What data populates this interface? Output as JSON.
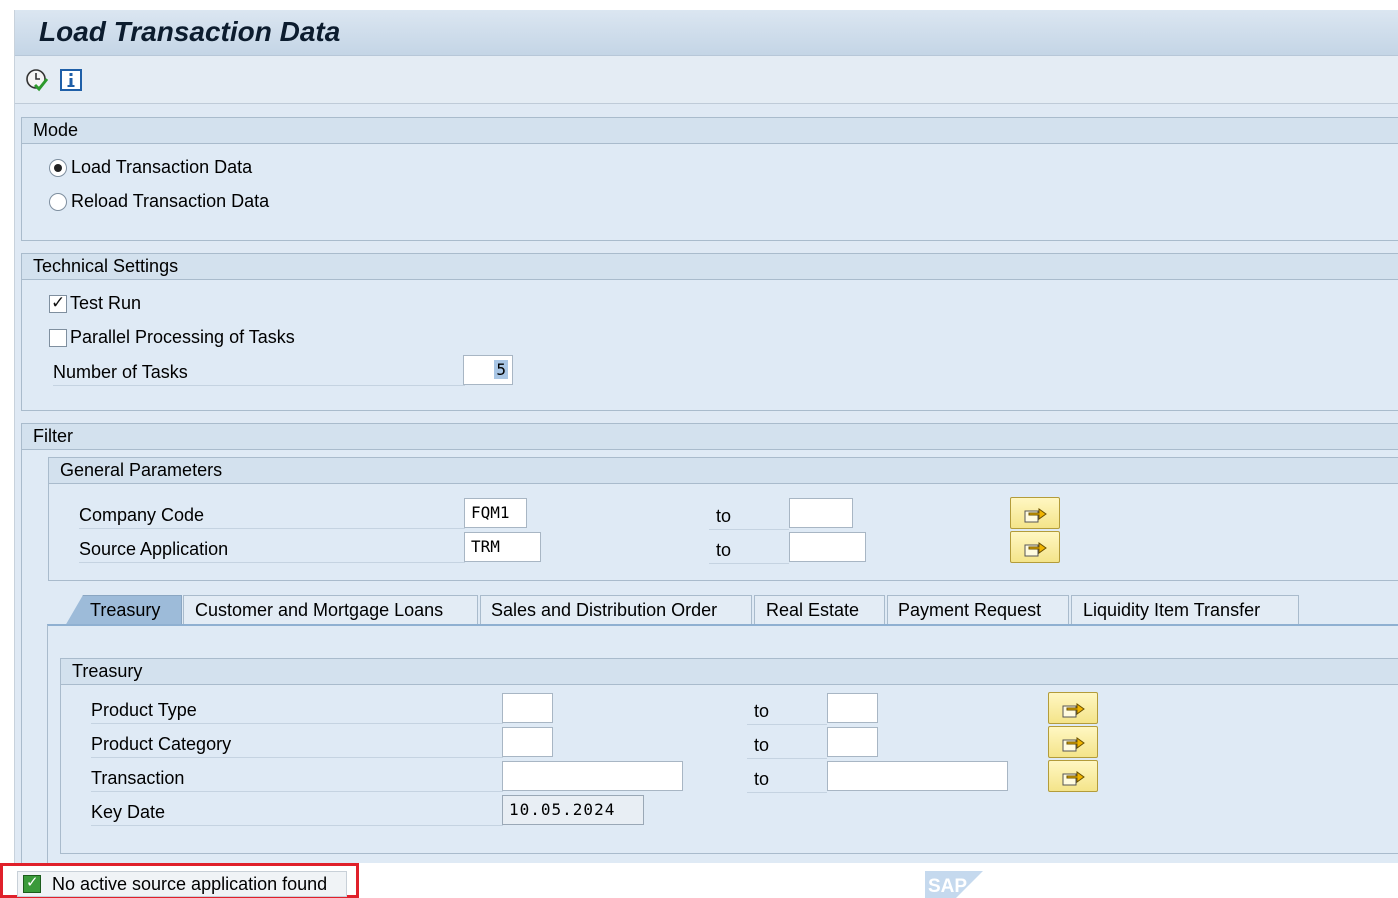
{
  "window": {
    "title": "Load Transaction Data"
  },
  "toolbar": {
    "execute_icon": "execute-clock-icon",
    "info_icon": "info-icon"
  },
  "mode": {
    "title": "Mode",
    "options": [
      {
        "label": "Load Transaction Data",
        "selected": true
      },
      {
        "label": "Reload Transaction Data",
        "selected": false
      }
    ]
  },
  "technical": {
    "title": "Technical Settings",
    "test_run": {
      "label": "Test Run",
      "checked": true
    },
    "parallel": {
      "label": "Parallel Processing of Tasks",
      "checked": false
    },
    "num_tasks": {
      "label": "Number of Tasks",
      "value": "5"
    }
  },
  "filter": {
    "title": "Filter",
    "general": {
      "title": "General Parameters",
      "rows": [
        {
          "label": "Company Code",
          "from": "FQM1",
          "to_label": "to",
          "to": ""
        },
        {
          "label": "Source Application",
          "from": "TRM",
          "to_label": "to",
          "to": ""
        }
      ]
    },
    "tabs": [
      {
        "label": "Treasury",
        "active": true
      },
      {
        "label": "Customer and Mortgage Loans",
        "active": false
      },
      {
        "label": "Sales and Distribution Order",
        "active": false
      },
      {
        "label": "Real Estate",
        "active": false
      },
      {
        "label": "Payment Request",
        "active": false
      },
      {
        "label": "Liquidity Item Transfer",
        "active": false
      }
    ],
    "treasury": {
      "title": "Treasury",
      "rows": [
        {
          "label": "Product Type",
          "from": "",
          "to_label": "to",
          "to": ""
        },
        {
          "label": "Product Category",
          "from": "",
          "to_label": "to",
          "to": ""
        },
        {
          "label": "Transaction",
          "from": "",
          "to_label": "to",
          "to": ""
        }
      ],
      "key_date": {
        "label": "Key Date",
        "value": "10.05.2024"
      }
    }
  },
  "status": {
    "message": "No active source application found",
    "type": "success"
  },
  "brand": {
    "logo_text": "SAP"
  },
  "colors": {
    "background": "#dfe9f4",
    "status_highlight": "#e0202a",
    "range_button": "#f4e48a"
  }
}
